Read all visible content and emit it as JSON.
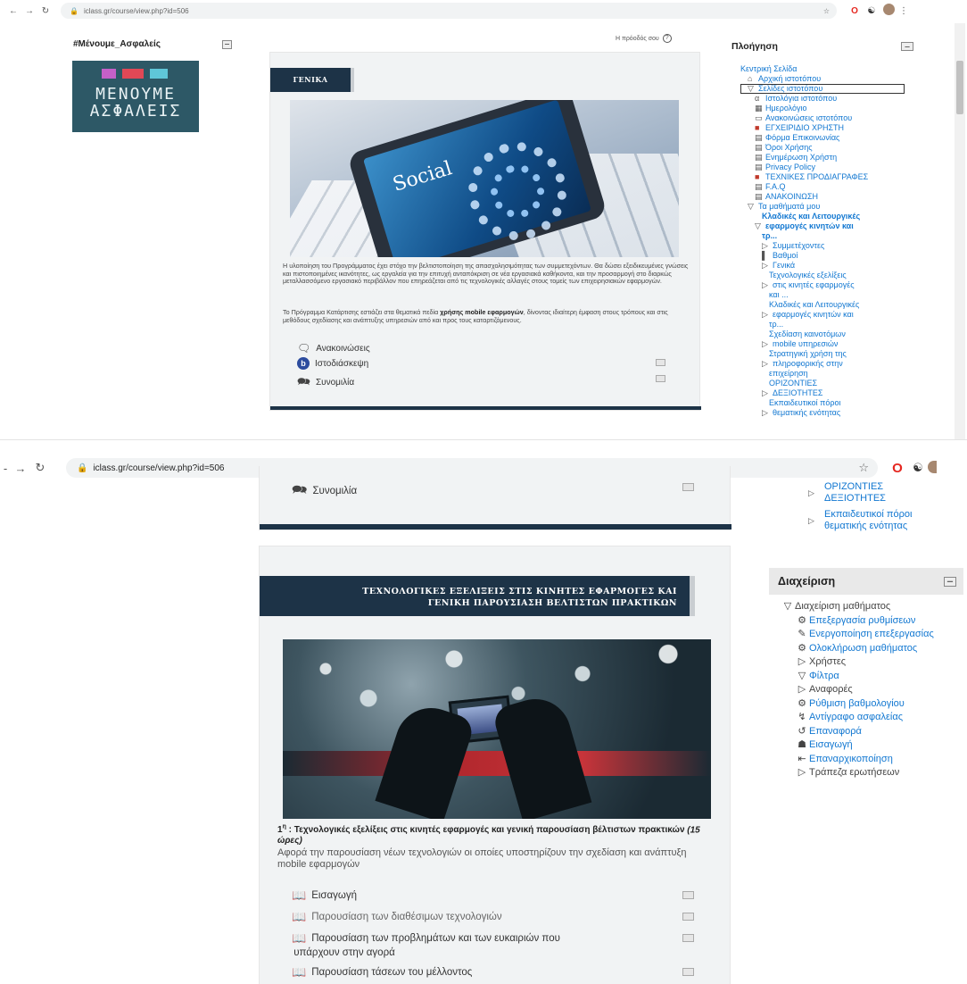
{
  "browser": {
    "url": "iclass.gr/course/view.php?id=506"
  },
  "top": {
    "left_block_title": "#Μένουμε_Ασφαλείς",
    "logo_text": [
      "ΜΕΝΟΥΜΕ",
      "ΑΣΦΑΛΕΙΣ"
    ],
    "progress_label": "Η πρόοδός σου",
    "section_title": "ΓΕΝΙΚΑ",
    "phone_text": "Social",
    "para1": "Η υλοποίηση του Προγράμματος έχει στόχο την βελτιστοποίηση της απασχολησιμότητας  των συμμετεχόντων. Θα δώσει εξειδικευμένες γνώσεις και πιστοποιημένες ικανότητες, ως εργαλεία για την επιτυχή ανταπόκριση σε νέα εργασιακά καθήκοντα, και την προσαρμογή στο διαρκώς μεταλλασσόμενο εργασιακό περιβάλλον που επηρεάζεται από τις τεχνολογικές αλλαγές στους τομείς των επιχειρησιακών εφαρμογών.",
    "para2_before": "Το Πρόγραμμα Κατάρτισης εστιάζει  στα θεματικά πεδία  ",
    "para2_bold": "χρήσης mobile εφαρμογών",
    "para2_after": ", δίνοντας ιδιαίτερη έμφαση στους τρόπους και στις μεθόδους σχεδίασης και ανάπτυξης υπηρεσιών από και προς τους καταρτιζόμενους.",
    "activities": [
      "Ανακοινώσεις",
      "Ιστοδιάσκεψη",
      "Συνομιλία"
    ],
    "nav_title": "Πλοήγηση",
    "nav_items": [
      {
        "t": "Κεντρική Σελίδα",
        "ind": 0,
        "i": ""
      },
      {
        "t": "Αρχική ιστοτόπου",
        "ind": 1,
        "i": "⌂"
      },
      {
        "t": "Σελίδες ιστοτόπου",
        "ind": 1,
        "i": "▽"
      },
      {
        "t": "Ιστολόγια ιστοτόπου",
        "ind": 2,
        "i": "α"
      },
      {
        "t": "Ημερολόγιο",
        "ind": 2,
        "i": "▦"
      },
      {
        "t": "Ανακοινώσεις ιστοτόπου",
        "ind": 2,
        "i": "▭"
      },
      {
        "t": "ΕΓΧΕΙΡΙΔΙΟ ΧΡΗΣΤΗ",
        "ind": 2,
        "i": "■"
      },
      {
        "t": "Φόρμα Επικοινωνίας",
        "ind": 2,
        "i": "▤"
      },
      {
        "t": "Όροι Χρήσης",
        "ind": 2,
        "i": "▤"
      },
      {
        "t": "Ενημέρωση Χρήστη",
        "ind": 2,
        "i": "▤"
      },
      {
        "t": "Privacy Policy",
        "ind": 2,
        "i": "▤"
      },
      {
        "t": "ΤΕΧΝΙΚΕΣ ΠΡΟΔΙΑΓΡΑΦΕΣ",
        "ind": 2,
        "i": "■"
      },
      {
        "t": "F.A.Q",
        "ind": 2,
        "i": "▤"
      },
      {
        "t": "ΑΝΑΚΟΙΝΩΣΗ",
        "ind": 2,
        "i": "▤"
      },
      {
        "t": "Τα μαθήματά μου",
        "ind": 1,
        "i": "▽"
      },
      {
        "t": "Κλαδικές και Λειτουργικές",
        "ind": 3,
        "i": "",
        "b": 1
      },
      {
        "t": "εφαρμογές κινητών και",
        "ind": 2,
        "i": "▽",
        "b": 1
      },
      {
        "t": "τρ...",
        "ind": 3,
        "i": "",
        "b": 1
      },
      {
        "t": "Συμμετέχοντες",
        "ind": 3,
        "i": "▷"
      },
      {
        "t": "Βαθμοί",
        "ind": 3,
        "i": "▌"
      },
      {
        "t": "Γενικά",
        "ind": 3,
        "i": "▷"
      },
      {
        "t": "Τεχνολογικές εξελίξεις",
        "ind": 4,
        "i": ""
      },
      {
        "t": "στις κινητές εφαρμογές",
        "ind": 3,
        "i": "▷"
      },
      {
        "t": "και ...",
        "ind": 4,
        "i": ""
      },
      {
        "t": "Κλαδικές και Λειτουργικές",
        "ind": 4,
        "i": ""
      },
      {
        "t": "εφαρμογές κινητών και",
        "ind": 3,
        "i": "▷"
      },
      {
        "t": "τρ...",
        "ind": 4,
        "i": ""
      },
      {
        "t": "Σχεδίαση καινοτόμων",
        "ind": 4,
        "i": ""
      },
      {
        "t": "mobile υπηρεσιών",
        "ind": 3,
        "i": "▷"
      },
      {
        "t": "Στρατηγική χρήση της",
        "ind": 4,
        "i": ""
      },
      {
        "t": "πληροφορικής στην",
        "ind": 3,
        "i": "▷"
      },
      {
        "t": "επιχείρηση",
        "ind": 4,
        "i": ""
      },
      {
        "t": "ΟΡΙΖΟΝΤΙΕΣ",
        "ind": 4,
        "i": ""
      },
      {
        "t": "ΔΕΞΙΟΤΗΤΕΣ",
        "ind": 3,
        "i": "▷"
      },
      {
        "t": "Εκπαιδευτικοί πόροι",
        "ind": 4,
        "i": ""
      },
      {
        "t": "θεματικής ενότητας",
        "ind": 3,
        "i": "▷"
      }
    ]
  },
  "bottom": {
    "act_top": "Συνομιλία",
    "nav_tail": [
      "ΟΡΙΖΟΝΤΙΕΣ",
      "ΔΕΞΙΟΤΗΤΕΣ",
      "Εκπαιδευτικοί πόροι",
      "θεματικής ενότητας"
    ],
    "section_title_1": "ΤΕΧΝΟΛΟΓΙΚΕΣ ΕΞΕΛΙΞΕΙΣ ΣΤΙΣ ΚΙΝΗΤΕΣ ΕΦΑΡΜΟΓΕΣ ΚΑΙ",
    "section_title_2": "ΓΕΝΙΚΗ ΠΑΡΟΥΣΙΑΣΗ ΒΕΛΤΙΣΤΩΝ ΠΡΑΚΤΙΚΩΝ",
    "summary_num": "1",
    "summary_sup": "η",
    "summary_bold": " : Τεχνολογικές εξελίξεις στις κινητές εφαρμογές και γενική παρουσίαση βέλτιστων πρακτικών",
    "summary_hours": "(15 ώρες)",
    "summary_desc": "Αφορά την παρουσίαση νέων τεχνολογιών οι οποίες υποστηρίζουν την σχεδίαση και ανάπτυξη mobile εφαρμογών",
    "activities": [
      "Εισαγωγή",
      "Παρουσίαση των διαθέσιμων τεχνολογιών",
      "Παρουσίαση των προβλημάτων και των ευκαιριών που",
      "υπάρχουν στην αγορά",
      "Παρουσίαση τάσεων του μέλλοντος"
    ],
    "admin_title": "Διαχείριση",
    "admin_items": [
      {
        "t": "Διαχείριση μαθήματος",
        "ind": 0,
        "i": "▽",
        "dark": 1
      },
      {
        "t": "Επεξεργασία ρυθμίσεων",
        "ind": 1,
        "i": "⚙"
      },
      {
        "t": "Ενεργοποίηση επεξεργασίας",
        "ind": 1,
        "i": "✎"
      },
      {
        "t": "Ολοκλήρωση μαθήματος",
        "ind": 1,
        "i": "⚙"
      },
      {
        "t": "Χρήστες",
        "ind": 1,
        "i": "▷",
        "dark": 1
      },
      {
        "t": "Φίλτρα",
        "ind": 1,
        "i": "▽"
      },
      {
        "t": "Αναφορές",
        "ind": 1,
        "i": "▷",
        "dark": 1
      },
      {
        "t": "Ρύθμιση βαθμολογίου",
        "ind": 1,
        "i": "⚙"
      },
      {
        "t": "Αντίγραφο ασφαλείας",
        "ind": 1,
        "i": "↯"
      },
      {
        "t": "Επαναφορά",
        "ind": 1,
        "i": "↺"
      },
      {
        "t": "Εισαγωγή",
        "ind": 1,
        "i": "☗"
      },
      {
        "t": "Επαναρχικοποίηση",
        "ind": 1,
        "i": "⇤"
      },
      {
        "t": "Τράπεζα ερωτήσεων",
        "ind": 1,
        "i": "▷",
        "dark": 1
      }
    ]
  },
  "colors": {
    "section_header": "#1d3347",
    "link": "#1177d1",
    "logo_bg": "#2d5866",
    "opera_red": "#e5261f"
  }
}
